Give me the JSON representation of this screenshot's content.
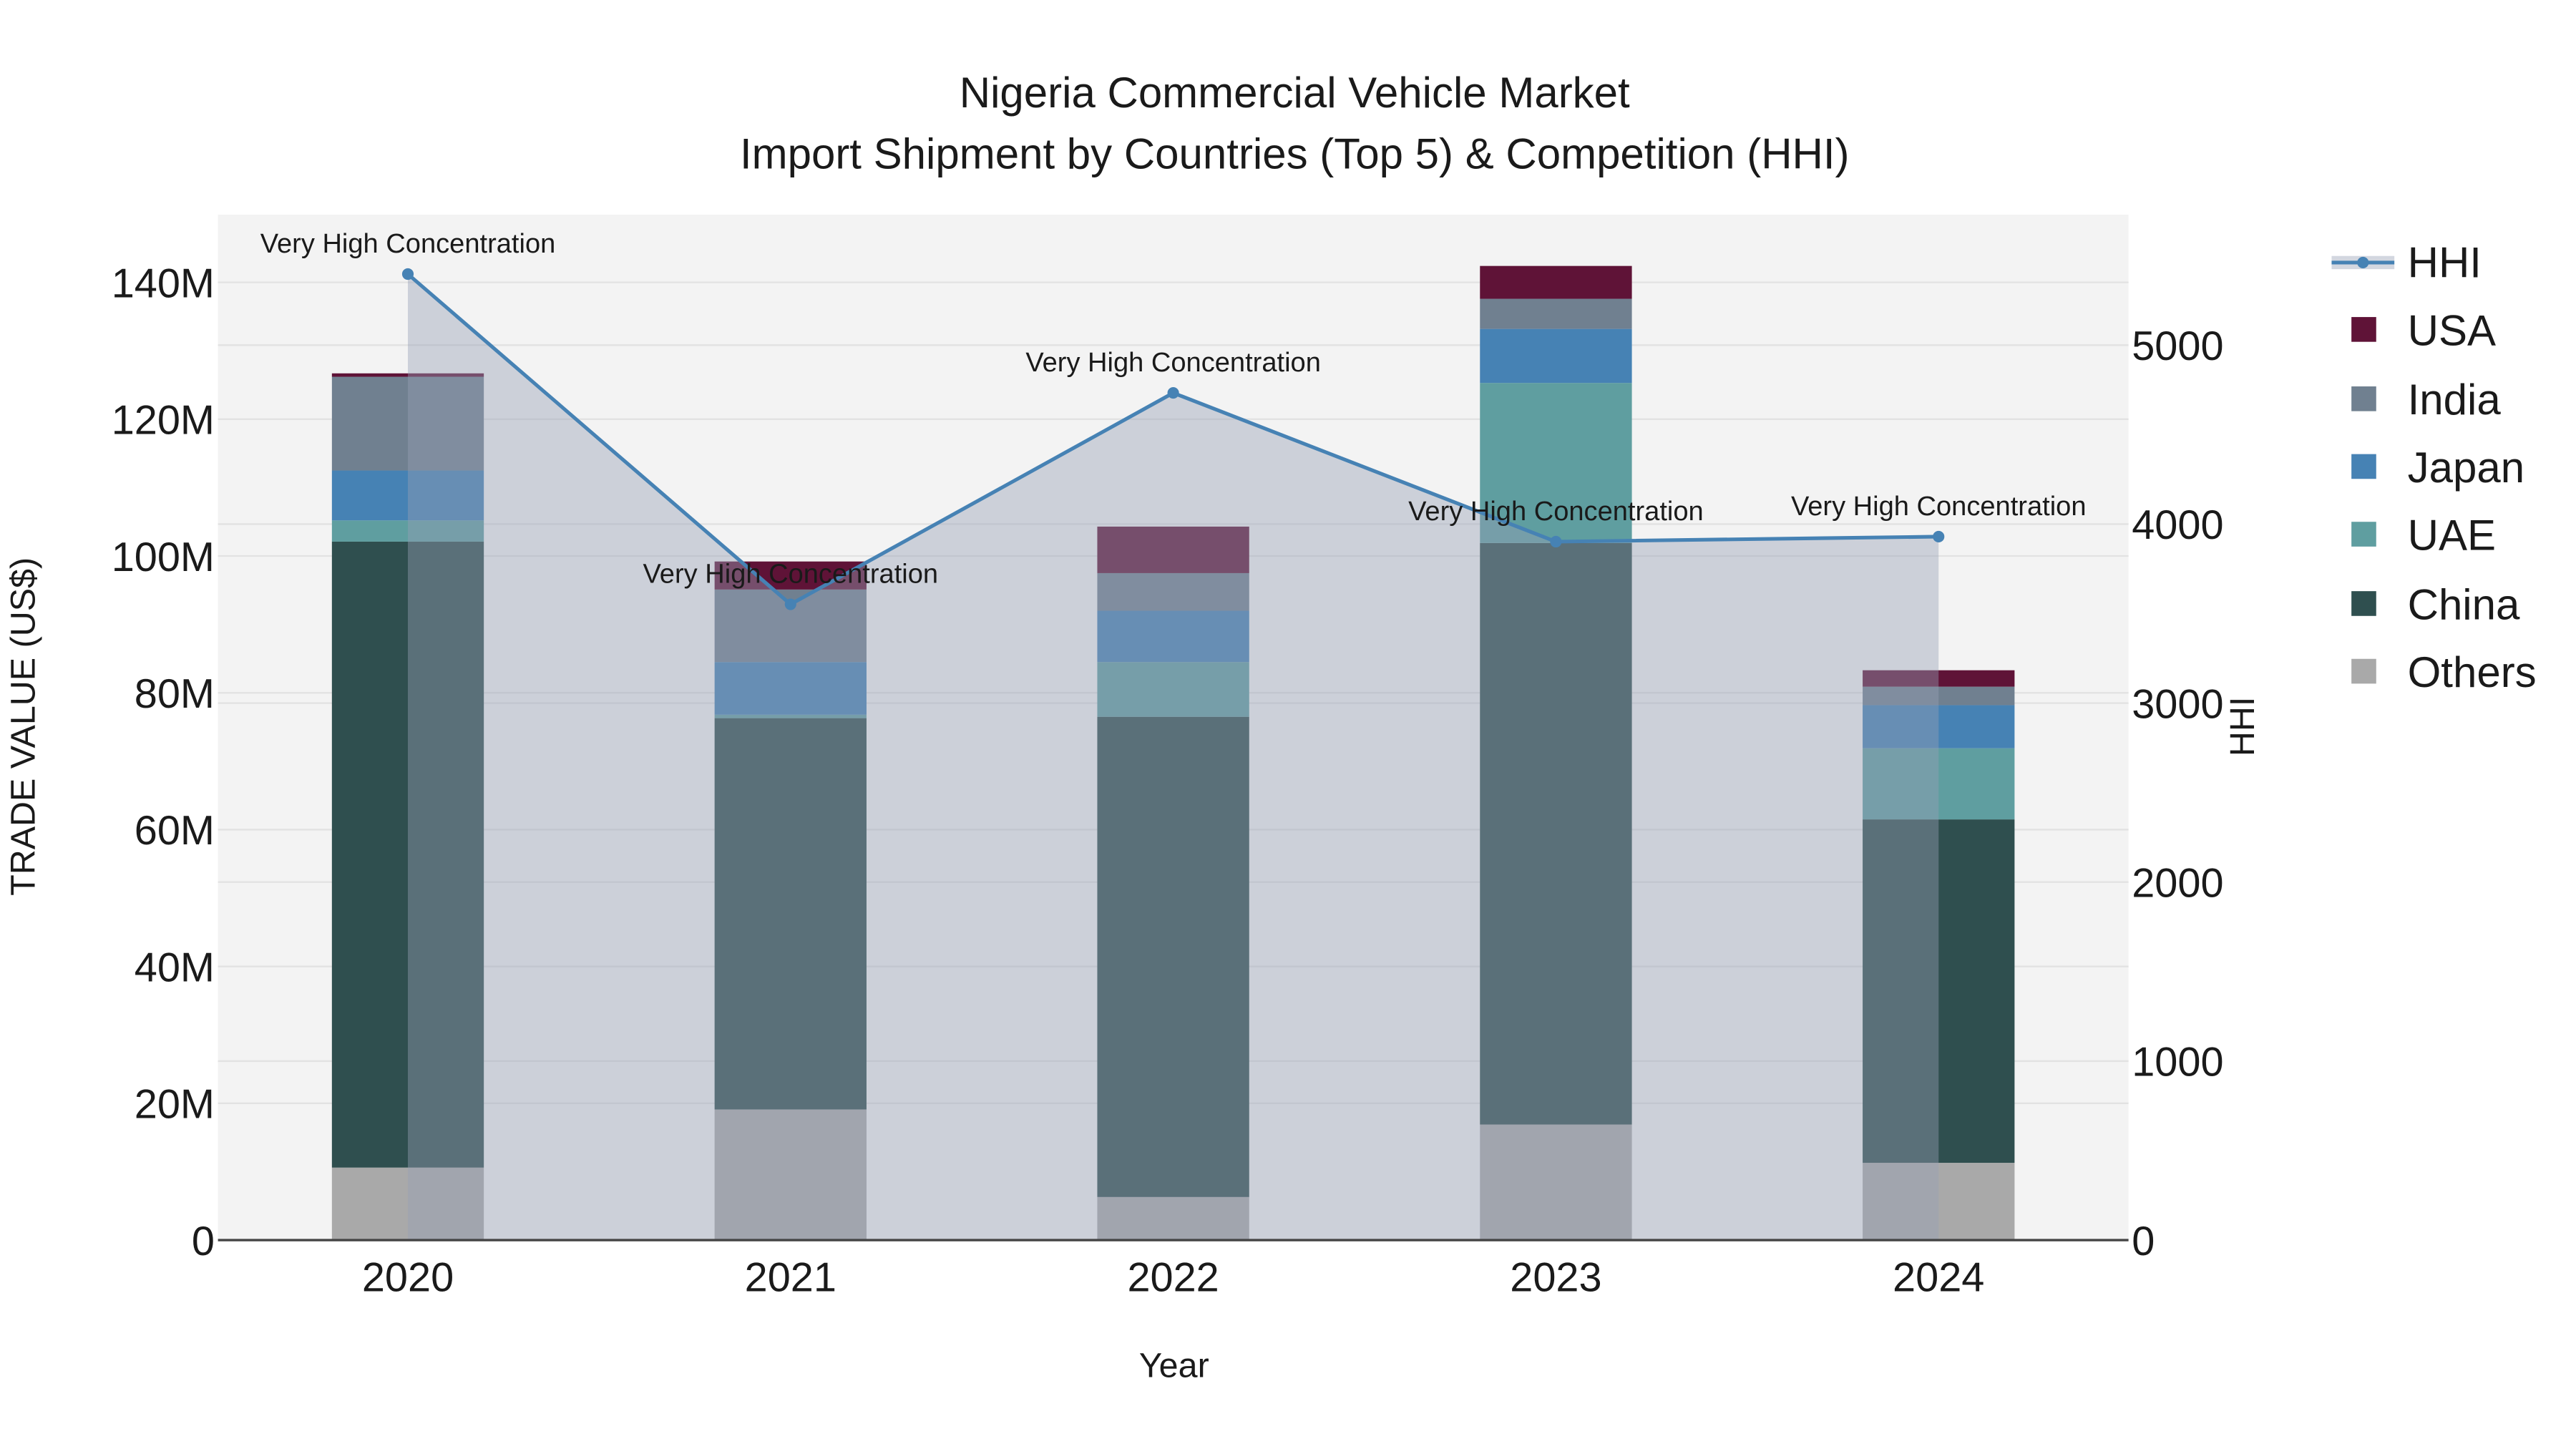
{
  "chart_data": {
    "type": "bar",
    "stacked": true,
    "title": "Nigeria Commercial Vehicle Market",
    "subtitle": "Import Shipment by Countries (Top 5) & Competition (HHI)",
    "xlabel": "Year",
    "ylabel": "TRADE VALUE (US$)",
    "y2label": "HHI",
    "categories": [
      "2020",
      "2021",
      "2022",
      "2023",
      "2024"
    ],
    "ylim": [
      0,
      150000000
    ],
    "yticks": [
      0,
      20000000,
      40000000,
      60000000,
      80000000,
      100000000,
      120000000,
      140000000
    ],
    "ytick_labels": [
      "0",
      "20M",
      "40M",
      "60M",
      "80M",
      "100M",
      "120M",
      "140M"
    ],
    "y2lim": [
      0,
      5700
    ],
    "y2ticks": [
      0,
      1000,
      2000,
      3000,
      4000,
      5000
    ],
    "y2tick_labels": [
      "0",
      "1000",
      "2000",
      "3000",
      "4000",
      "5000"
    ],
    "grid": true,
    "legend_position": "right",
    "series": [
      {
        "name": "Others",
        "color": "#a9a9a9",
        "values": [
          10600000,
          19100000,
          6300000,
          16900000,
          11300000
        ]
      },
      {
        "name": "China",
        "color": "#2f4f4f",
        "values": [
          91500000,
          57200000,
          70200000,
          85000000,
          50200000
        ]
      },
      {
        "name": "UAE",
        "color": "#5f9ea0",
        "values": [
          3100000,
          500000,
          8000000,
          23400000,
          10400000
        ]
      },
      {
        "name": "Japan",
        "color": "#4682b4",
        "values": [
          7300000,
          7700000,
          7500000,
          7900000,
          6300000
        ]
      },
      {
        "name": "India",
        "color": "#708090",
        "values": [
          13700000,
          10600000,
          5500000,
          4400000,
          2700000
        ]
      },
      {
        "name": "USA",
        "color": "#5f1337",
        "values": [
          500000,
          4100000,
          6800000,
          4800000,
          2400000
        ]
      }
    ],
    "line_series": {
      "name": "HHI",
      "axis": "y2",
      "color": "#4682b4",
      "values": [
        5397,
        3552,
        4733,
        3902,
        3930
      ],
      "annotations": [
        "Very High Concentration",
        "Very High Concentration",
        "Very High Concentration",
        "Very High Concentration",
        "Very High Concentration"
      ]
    },
    "legend_order": [
      "HHI",
      "USA",
      "India",
      "Japan",
      "UAE",
      "China",
      "Others"
    ]
  }
}
